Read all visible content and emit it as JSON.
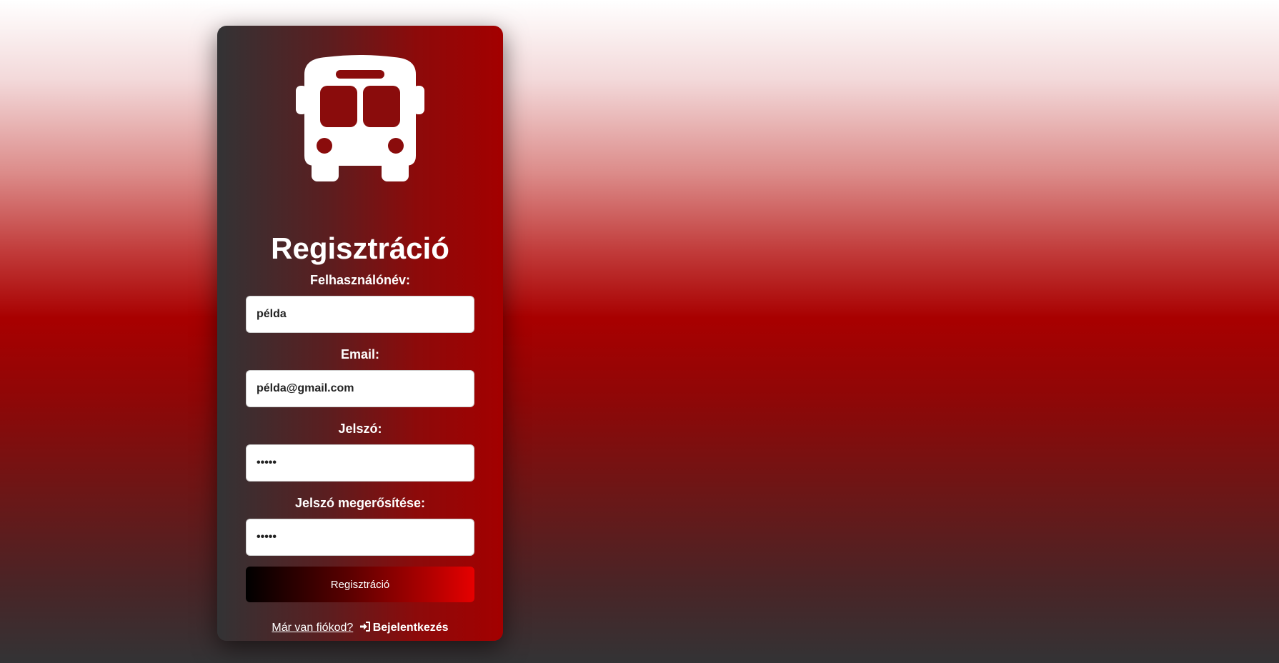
{
  "page": {
    "background_colors": [
      "#ffffff",
      "#a80000",
      "#333335"
    ]
  },
  "card": {
    "icon": "bus-icon",
    "title": "Regisztráció",
    "accent_color": "#a30000"
  },
  "form": {
    "username_label": "Felhasználónév:",
    "username_value": "példa",
    "email_label": "Email:",
    "email_value": "példa@gmail.com",
    "password_label": "Jelszó:",
    "password_value": "•••••",
    "confirm_label": "Jelszó megerősítése:",
    "confirm_value": "•••••",
    "submit_label": "Regisztráció"
  },
  "footer": {
    "question": "Már van fiókod?",
    "login_icon": "sign-in-icon",
    "login_label": "Bejelentkezés"
  }
}
